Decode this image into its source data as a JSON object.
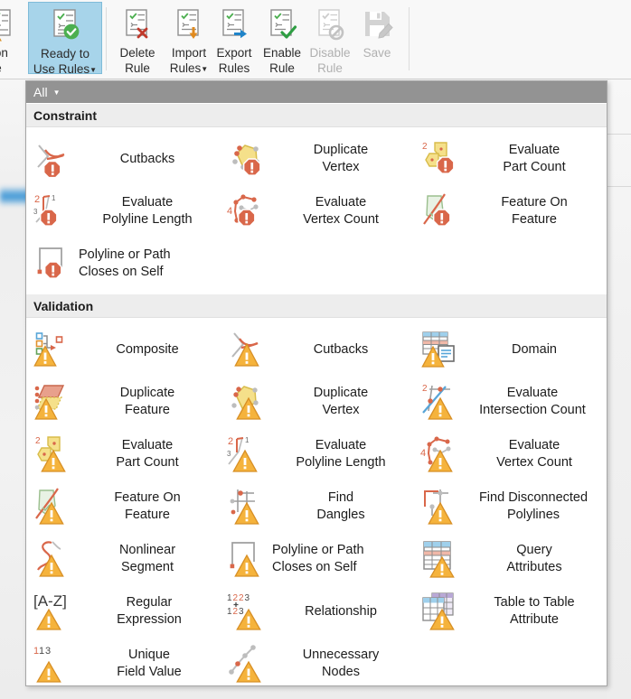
{
  "ribbon": {
    "groups": [
      {
        "name": "rules-group-left",
        "buttons": [
          {
            "label_line1": "tion",
            "label_line2": "e",
            "icon": "validation-rule-icon",
            "state": "partial"
          },
          {
            "label_line1": "Ready to",
            "label_line2": "Use Rules",
            "icon": "ready-to-use-rules-icon",
            "state": "selected",
            "has_caret": true
          }
        ]
      },
      {
        "name": "rules-group-right",
        "buttons": [
          {
            "label_line1": "Delete",
            "label_line2": "Rule",
            "icon": "delete-rule-icon",
            "state": "enabled"
          },
          {
            "label_line1": "Import",
            "label_line2": "Rules",
            "icon": "import-rules-icon",
            "state": "enabled",
            "has_caret": true
          },
          {
            "label_line1": "Export",
            "label_line2": "Rules",
            "icon": "export-rules-icon",
            "state": "enabled"
          },
          {
            "label_line1": "Enable",
            "label_line2": "Rule",
            "icon": "enable-rule-icon",
            "state": "enabled"
          },
          {
            "label_line1": "Disable",
            "label_line2": "Rule",
            "icon": "disable-rule-icon",
            "state": "disabled"
          },
          {
            "label_line1": "Save",
            "label_line2": "",
            "icon": "save-icon",
            "state": "disabled"
          }
        ]
      }
    ]
  },
  "gallery": {
    "filter": {
      "label": "All",
      "caret": "▼"
    },
    "sections": [
      {
        "title": "Constraint",
        "badge": "constraint",
        "items": [
          {
            "line1": "Cutbacks",
            "line2": "",
            "icon": "cutbacks-icon"
          },
          {
            "line1": "Duplicate",
            "line2": "Vertex",
            "icon": "duplicate-vertex-icon"
          },
          {
            "line1": "Evaluate",
            "line2": "Part Count",
            "icon": "evaluate-part-count-icon"
          },
          {
            "line1": "Evaluate",
            "line2": "Polyline Length",
            "icon": "evaluate-polyline-length-icon"
          },
          {
            "line1": "Evaluate",
            "line2": "Vertex Count",
            "icon": "evaluate-vertex-count-icon"
          },
          {
            "line1": "Feature On",
            "line2": "Feature",
            "icon": "feature-on-feature-icon"
          },
          {
            "line1": "Polyline or Path",
            "line2": "Closes on Self",
            "icon": "polyline-closes-on-self-icon"
          }
        ]
      },
      {
        "title": "Validation",
        "badge": "validation",
        "items": [
          {
            "line1": "Composite",
            "line2": "",
            "icon": "composite-icon"
          },
          {
            "line1": "Cutbacks",
            "line2": "",
            "icon": "cutbacks-icon"
          },
          {
            "line1": "Domain",
            "line2": "",
            "icon": "domain-icon"
          },
          {
            "line1": "Duplicate",
            "line2": "Feature",
            "icon": "duplicate-feature-icon"
          },
          {
            "line1": "Duplicate",
            "line2": "Vertex",
            "icon": "duplicate-vertex-icon"
          },
          {
            "line1": "Evaluate",
            "line2": "Intersection Count",
            "icon": "evaluate-intersection-count-icon"
          },
          {
            "line1": "Evaluate",
            "line2": "Part Count",
            "icon": "evaluate-part-count-icon"
          },
          {
            "line1": "Evaluate",
            "line2": "Polyline Length",
            "icon": "evaluate-polyline-length-icon"
          },
          {
            "line1": "Evaluate",
            "line2": "Vertex Count",
            "icon": "evaluate-vertex-count-icon"
          },
          {
            "line1": "Feature On",
            "line2": "Feature",
            "icon": "feature-on-feature-icon"
          },
          {
            "line1": "Find",
            "line2": "Dangles",
            "icon": "find-dangles-icon"
          },
          {
            "line1": "Find Disconnected",
            "line2": "Polylines",
            "icon": "find-disconnected-polylines-icon"
          },
          {
            "line1": "Nonlinear",
            "line2": "Segment",
            "icon": "nonlinear-segment-icon"
          },
          {
            "line1": "Polyline or Path",
            "line2": "Closes on Self",
            "icon": "polyline-closes-on-self-icon"
          },
          {
            "line1": "Query",
            "line2": "Attributes",
            "icon": "query-attributes-icon"
          },
          {
            "line1": "Regular",
            "line2": "Expression",
            "icon": "regular-expression-icon"
          },
          {
            "line1": "Relationship",
            "line2": "",
            "icon": "relationship-icon"
          },
          {
            "line1": "Table to Table",
            "line2": "Attribute",
            "icon": "table-to-table-attribute-icon"
          },
          {
            "line1": "Unique",
            "line2": "Field Value",
            "icon": "unique-field-value-icon"
          },
          {
            "line1": "Unnecessary",
            "line2": "Nodes",
            "icon": "unnecessary-nodes-icon"
          }
        ]
      }
    ]
  },
  "colors": {
    "selected_button": "#a7d4ea",
    "filter_bar": "#939393",
    "section_header": "#ededed",
    "constraint_badge": "#d9674a",
    "validation_badge": "#f0a940",
    "accent_red": "#d9674a",
    "accent_green": "#4caf50"
  }
}
